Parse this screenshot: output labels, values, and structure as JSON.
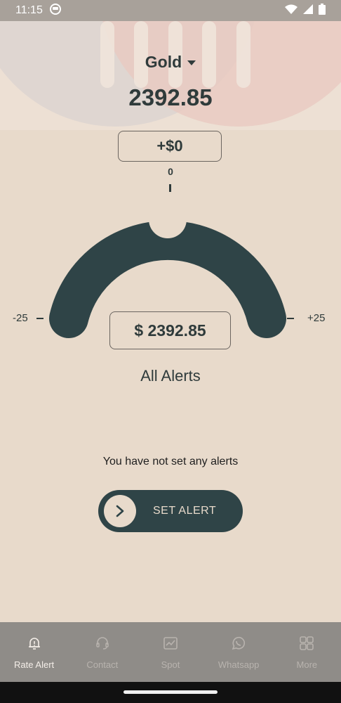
{
  "status_bar": {
    "time": "11:15"
  },
  "header": {
    "metal": "Gold",
    "price": "2392.85"
  },
  "gauge": {
    "offset_label": "+$0",
    "zero_label": "0",
    "min_label": "-25",
    "max_label": "+25",
    "price_label": "$ 2392.85",
    "value_fraction": 0.5
  },
  "alerts": {
    "title": "All Alerts",
    "empty_message": "You have not set any alerts",
    "button_label": "SET ALERT"
  },
  "nav": {
    "items": [
      {
        "label": "Rate Alert",
        "icon": "bell-alert-icon",
        "active": true
      },
      {
        "label": "Contact",
        "icon": "headset-icon",
        "active": false
      },
      {
        "label": "Spot",
        "icon": "chart-icon",
        "active": false
      },
      {
        "label": "Whatsapp",
        "icon": "whatsapp-icon",
        "active": false
      },
      {
        "label": "More",
        "icon": "grid-icon",
        "active": false
      }
    ]
  },
  "colors": {
    "background": "#E8DACB",
    "primary": "#2F4447",
    "nav_background": "#8F8C88"
  }
}
